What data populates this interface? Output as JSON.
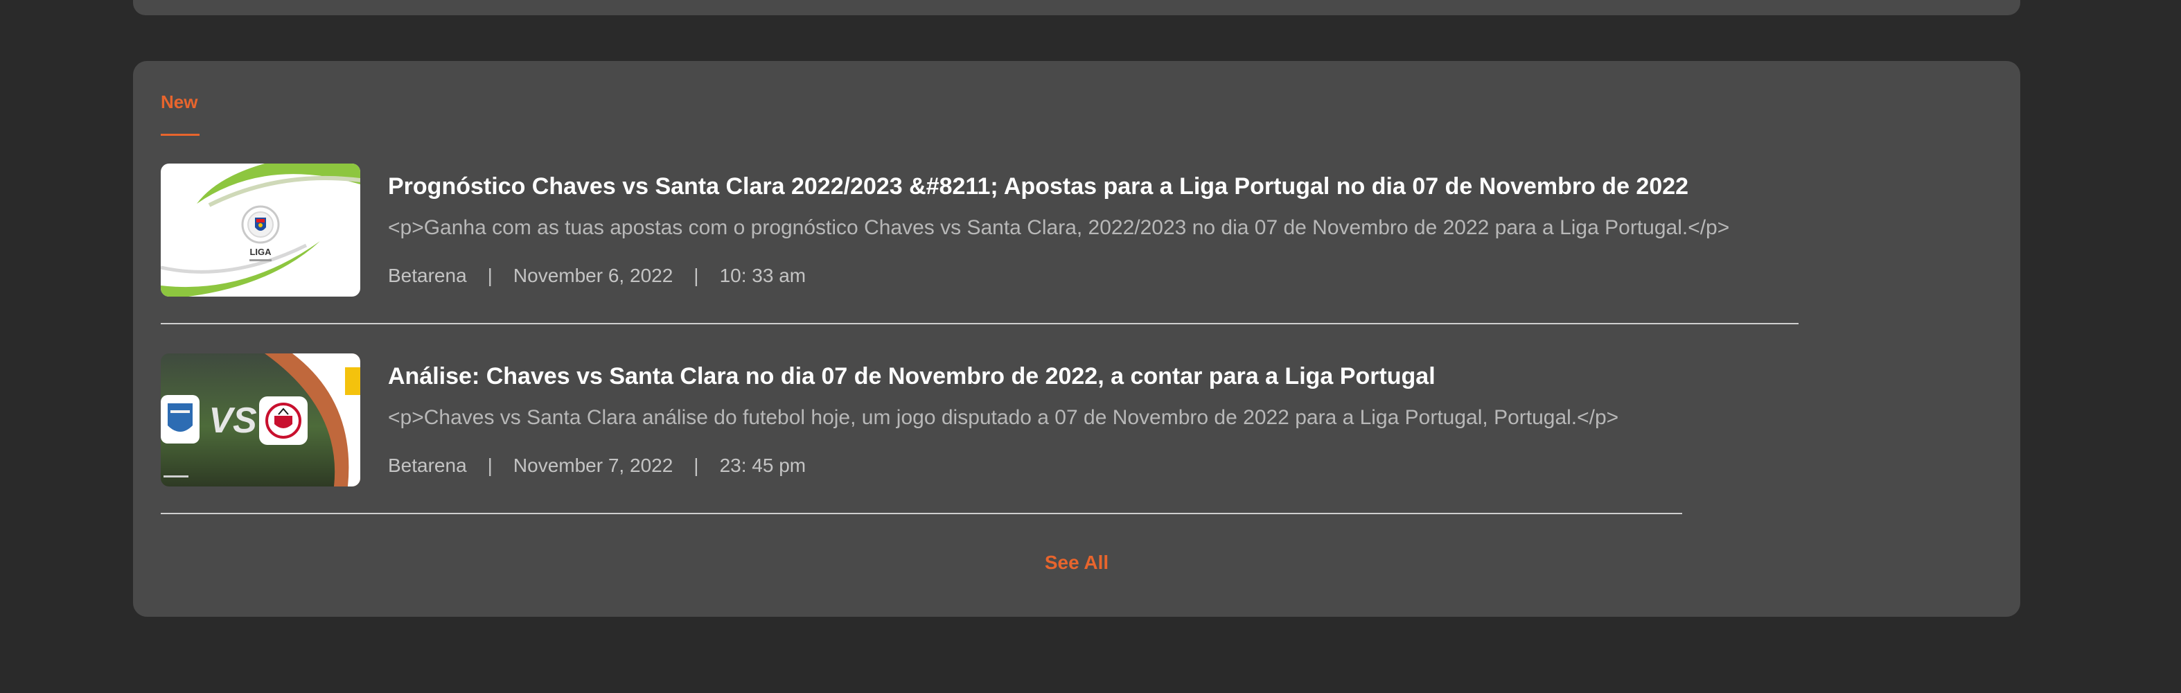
{
  "tabs": {
    "active_label": "New"
  },
  "articles": [
    {
      "title": "Prognóstico Chaves vs Santa Clara 2022/2023 &#8211; Apostas para a Liga Portugal no dia 07 de Novembro de 2022",
      "description": "<p>Ganha com as tuas apostas com o prognóstico Chaves vs Santa Clara, 2022/2023 no dia 07 de Novembro de 2022 para a Liga Portugal.</p>",
      "author": "Betarena",
      "separator": "|",
      "date": "November 6, 2022",
      "time": "10: 33 am",
      "thumbnail_logo_text": "LIGA"
    },
    {
      "title": "Análise: Chaves vs Santa Clara no dia 07 de Novembro de 2022, a contar para a Liga Portugal",
      "description": "<p>Chaves vs Santa Clara análise do futebol hoje, um jogo disputado a 07 de Novembro de 2022 para a Liga Portugal, Portugal.</p>",
      "author": "Betarena",
      "separator": "|",
      "date": "November 7, 2022",
      "time": "23: 45 pm",
      "thumbnail_vs_text": "VS"
    }
  ],
  "see_all_label": "See All",
  "colors": {
    "accent": "#e8652d",
    "card": "#4a4a4a",
    "background": "#2a2a2a"
  }
}
